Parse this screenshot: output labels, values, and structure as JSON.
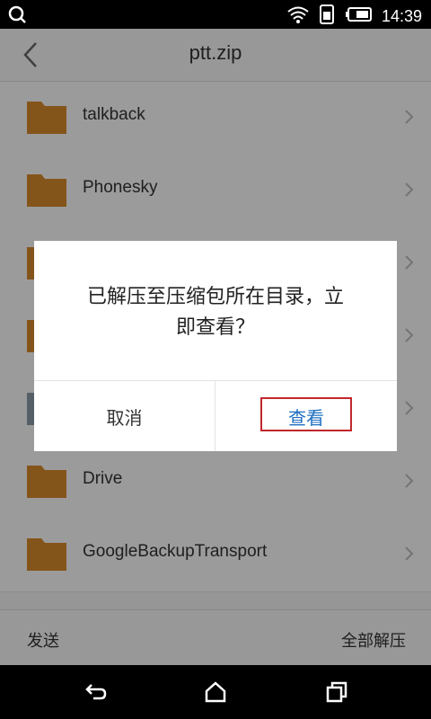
{
  "status_bar": {
    "time": "14:39",
    "icons": [
      "search-icon",
      "wifi-icon",
      "sim-icon",
      "battery-icon"
    ]
  },
  "topbar": {
    "title": "ptt.zip",
    "back_icon": "chevron-left-icon"
  },
  "list": {
    "items": [
      {
        "label": "talkback",
        "icon": "folder-icon"
      },
      {
        "label": "Phonesky",
        "icon": "folder-icon"
      },
      {
        "label": "",
        "icon": "folder-icon"
      },
      {
        "label": "",
        "icon": "folder-icon"
      },
      {
        "label": "",
        "icon": "folder-icon"
      },
      {
        "label": "Drive",
        "icon": "folder-icon"
      },
      {
        "label": "GoogleBackupTransport",
        "icon": "folder-icon"
      }
    ]
  },
  "bottom_bar": {
    "left_label": "发送",
    "right_label": "全部解压"
  },
  "dialog": {
    "message_line1": "已解压至压缩包所在目录，立",
    "message_line2": "即查看？",
    "cancel_label": "取消",
    "view_label": "查看",
    "view_color": "#1e6fc0",
    "highlight_color": "#c0282c"
  },
  "nav_bar": {
    "icons": [
      "back-icon",
      "home-icon",
      "recents-icon"
    ]
  },
  "colors": {
    "folder": "#d6892b",
    "status_bar": "#000000",
    "background": "#f3f3f3"
  }
}
